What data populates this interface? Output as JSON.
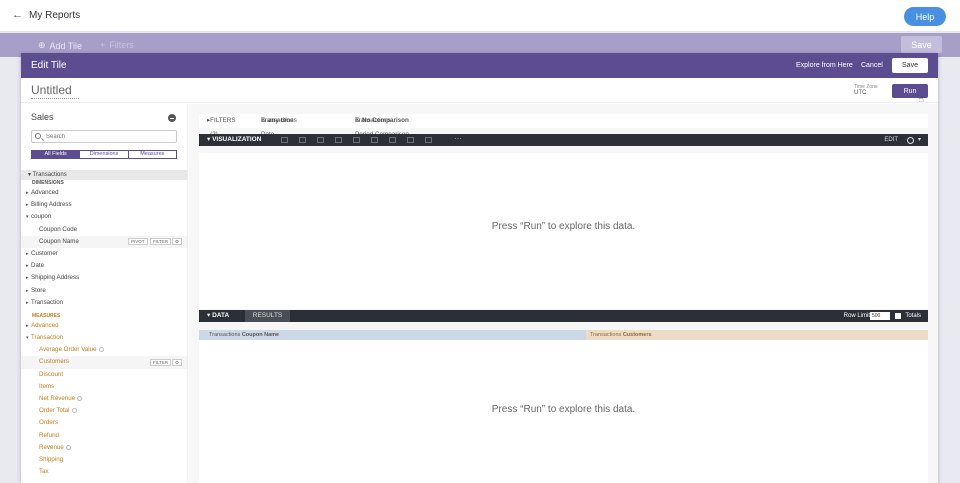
{
  "header": {
    "back_label": "My Reports",
    "help_label": "Help"
  },
  "dim_bar": {
    "add_tile": "Add Tile",
    "filters": "Filters",
    "save": "Save"
  },
  "modal": {
    "title": "Edit Tile",
    "explore_from_here": "Explore from Here",
    "cancel": "Cancel",
    "save": "Save",
    "tile_title": "Untitled",
    "time_zone_label": "Time Zone",
    "time_zone_value": "UTC",
    "run": "Run"
  },
  "sidebar": {
    "explore_name": "Sales",
    "search_placeholder": "Search",
    "tabs": [
      "All Fields",
      "Dimensions",
      "Measures"
    ],
    "view": "Transactions",
    "dimensions_header": "DIMENSIONS",
    "dimensions": [
      {
        "label": "Advanced",
        "kind": "group"
      },
      {
        "label": "Billing Address",
        "kind": "group"
      },
      {
        "label": "coupon",
        "kind": "open"
      },
      {
        "label": "Coupon Code",
        "kind": "field"
      },
      {
        "label": "Coupon Name",
        "kind": "field",
        "pivot": "PIVOT",
        "filter": "FILTER"
      },
      {
        "label": "Customer",
        "kind": "group"
      },
      {
        "label": "Date",
        "kind": "group"
      },
      {
        "label": "Shipping Address",
        "kind": "group"
      },
      {
        "label": "Store",
        "kind": "group"
      },
      {
        "label": "Transaction",
        "kind": "group"
      }
    ],
    "measures_header": "MEASURES",
    "measures": [
      {
        "label": "Advanced",
        "kind": "group"
      },
      {
        "label": "Transaction",
        "kind": "open"
      },
      {
        "label": "Average Order Value",
        "kind": "field",
        "info": true
      },
      {
        "label": "Customers",
        "kind": "field",
        "filter": "FILTER"
      },
      {
        "label": "Discount",
        "kind": "field"
      },
      {
        "label": "Items",
        "kind": "field"
      },
      {
        "label": "Net Revenue",
        "kind": "field",
        "info": true
      },
      {
        "label": "Order Total",
        "kind": "field",
        "info": true
      },
      {
        "label": "Orders",
        "kind": "field"
      },
      {
        "label": "Refund",
        "kind": "field"
      },
      {
        "label": "Revenue",
        "kind": "field",
        "info": true
      },
      {
        "label": "Shipping",
        "kind": "field"
      },
      {
        "label": "Tax",
        "kind": "field"
      }
    ]
  },
  "filters": {
    "toggle": "FILTERS (2)",
    "f1_field": "Transactions Date",
    "f1_value": "is any time",
    "f2_field": "Transactions Period Comparison",
    "f2_value": "is No Comparison"
  },
  "visualization": {
    "label": "VISUALIZATION",
    "more": "···",
    "edit": "EDIT",
    "empty_message": "Press “Run” to explore this data."
  },
  "data": {
    "tab_data": "DATA",
    "tab_results": "RESULTS",
    "row_limit_label": "Row Limit",
    "row_limit_value": "500",
    "totals_label": "Totals",
    "col1_view": "Transactions",
    "col1_field": "Coupon Name",
    "col2_view": "Transactions",
    "col2_field": "Customers",
    "empty_message": "Press “Run” to explore this data."
  }
}
